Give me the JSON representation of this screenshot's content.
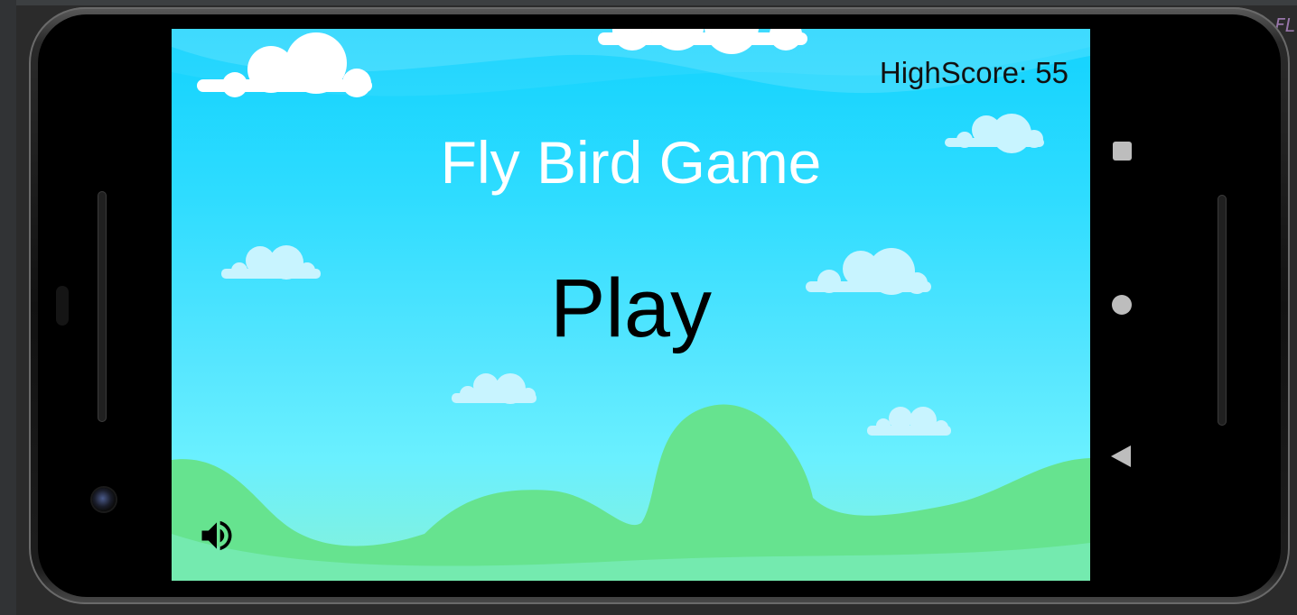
{
  "ide": {
    "corner_label": "FL"
  },
  "game": {
    "title": "Fly Bird Game",
    "play_label": "Play",
    "highscore_text": "HighScore: 55",
    "sound_icon": "volume-up-icon"
  },
  "device": {
    "nav_buttons": [
      "overview-square-icon",
      "home-circle-icon",
      "back-triangle-icon"
    ]
  },
  "colors": {
    "sky_top": "#12d2fe",
    "sky_bottom": "#6af0ff",
    "hills": "#66e38f",
    "cloud_white": "#ffffff",
    "cloud_light": "#c8f4ff",
    "title_text": "#ffffff",
    "play_text": "#000000"
  }
}
